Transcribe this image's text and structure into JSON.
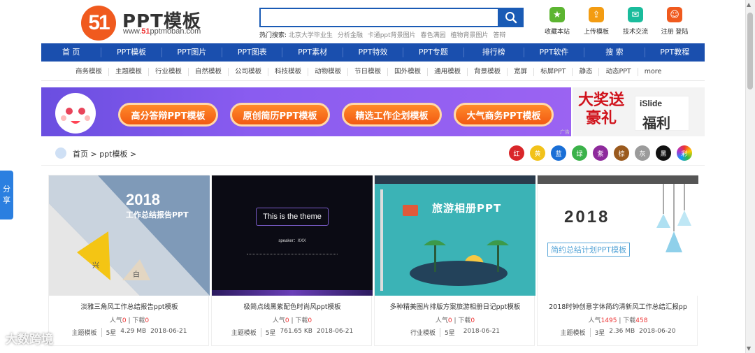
{
  "header": {
    "logo_mark": "51",
    "logo_title": "PPT模板",
    "logo_url_prefix": "www.",
    "logo_url_num": "51",
    "logo_url_suffix": "pptmoban.com",
    "search_placeholder": "",
    "hot_label": "热门搜索:",
    "hot_keywords": [
      "北京大学毕业生",
      "分析金融",
      "卡通ppt背景图片",
      "春色满园",
      "植物背景图片",
      "答辩"
    ],
    "icons": [
      {
        "label": "收藏本站",
        "icon": "star-icon",
        "color": "#5cb531"
      },
      {
        "label": "上传模板",
        "icon": "upload-icon",
        "color": "#f39c12"
      },
      {
        "label": "技术交流",
        "icon": "chat-icon",
        "color": "#1abc9c"
      },
      {
        "label": "注册 登陆",
        "icon": "user-icon",
        "color": "#f05a1e"
      }
    ]
  },
  "nav": [
    "首 页",
    "PPT模板",
    "PPT图片",
    "PPT图表",
    "PPT素材",
    "PPT特效",
    "PPT专题",
    "排行榜",
    "PPT软件",
    "搜 索",
    "PPT教程"
  ],
  "subnav": [
    "商务模板",
    "主题模板",
    "行业模板",
    "自然模板",
    "公司模板",
    "科技模板",
    "动物模板",
    "节日模板",
    "国外模板",
    "通用模板",
    "背景模板",
    "宽屏",
    "标屏PPT",
    "静态",
    "动态PPT",
    "more"
  ],
  "banner": {
    "buttons": [
      "高分答辩PPT模板",
      "原创简历PPT模板",
      "精选工作企划模板",
      "大气商务PPT模板"
    ],
    "ad_tag": "广告",
    "right_logo_text": "iSlide",
    "right_text": "福利",
    "left_text": "大奖送豪礼"
  },
  "breadcrumb": {
    "home": "首页",
    "sep": ">",
    "current": "ppt模板"
  },
  "color_filters": [
    {
      "label": "红",
      "color": "#d9262a"
    },
    {
      "label": "黄",
      "color": "#f2c21a"
    },
    {
      "label": "蓝",
      "color": "#1a6fd6"
    },
    {
      "label": "绿",
      "color": "#3bb24a"
    },
    {
      "label": "紫",
      "color": "#8e2a9c"
    },
    {
      "label": "棕",
      "color": "#9a5a1e"
    },
    {
      "label": "灰",
      "color": "#9b9b9b"
    },
    {
      "label": "黑",
      "color": "#111111"
    },
    {
      "label": "彩",
      "color": "#e85bb0"
    }
  ],
  "cards": [
    {
      "thumb_title": "2018",
      "thumb_sub": "工作总结报告PPT",
      "thumb_char1": "兴",
      "thumb_char2": "白",
      "caption": "淡雅三角风工作总结报告ppt模板",
      "pop_label": "人气",
      "pop": "0",
      "dl_label": "下载",
      "dl": "0",
      "category": "主题模板",
      "rating": "5星",
      "size": "4.29 MB",
      "date": "2018-06-21"
    },
    {
      "thumb_title": "This is the theme",
      "thumb_sub": "speaker：XXX",
      "caption": "极简点线黑紫配色时尚风ppt模板",
      "pop_label": "人气",
      "pop": "0",
      "dl_label": "下载",
      "dl": "0",
      "category": "主题模板",
      "rating": "5星",
      "size": "761.65 KB",
      "date": "2018-06-21"
    },
    {
      "thumb_title": "旅游相册PPT",
      "caption": "多种精美图片排版方案旅游相册日记ppt模板",
      "pop_label": "人气",
      "pop": "0",
      "dl_label": "下载",
      "dl": "0",
      "category": "行业模板",
      "rating": "5星",
      "size": "",
      "date": "2018-06-21"
    },
    {
      "thumb_title": "2018",
      "thumb_sub": "简约总结计划PPT模板",
      "caption": "2018时钟创意字体简约清新风工作总结汇报pp",
      "pop_label": "人气",
      "pop": "1495",
      "dl_label": "下载",
      "dl": "458",
      "category": "主题模板",
      "rating": "3星",
      "size": "2.36 MB",
      "date": "2018-06-20"
    }
  ],
  "share": {
    "line1": "分",
    "line2": "享"
  },
  "watermark": "大数跨境"
}
